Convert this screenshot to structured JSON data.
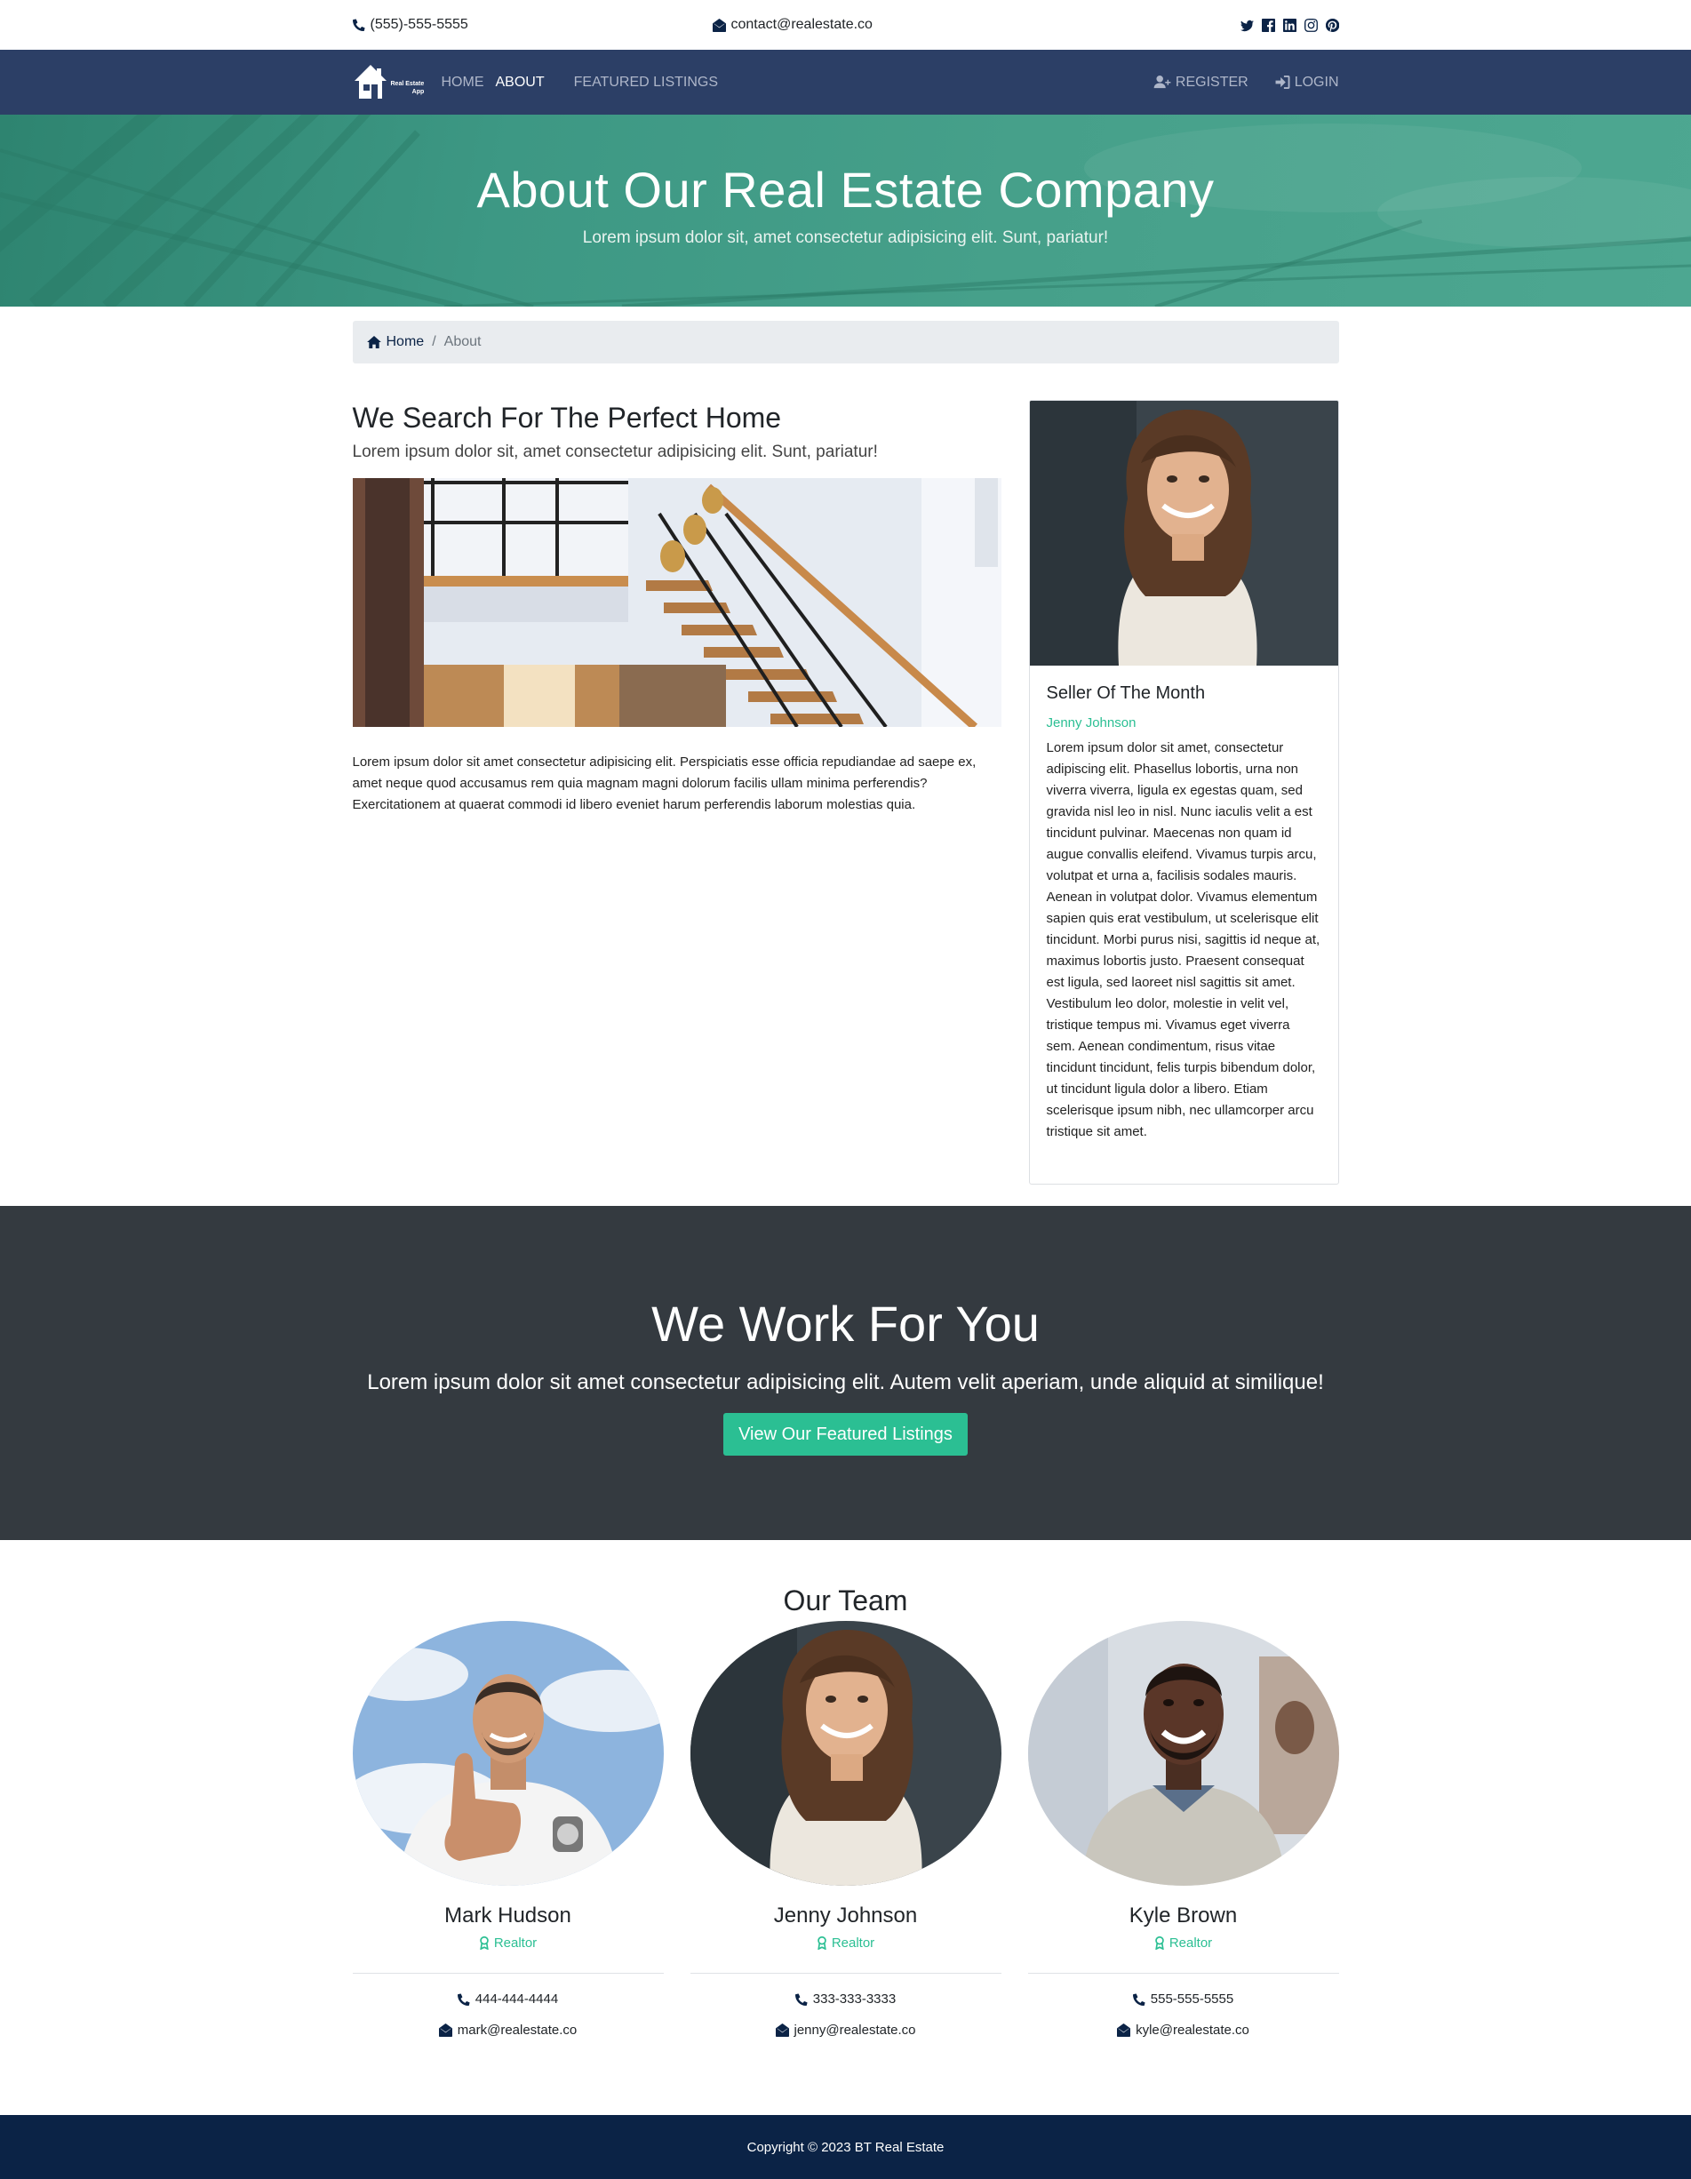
{
  "topbar": {
    "phone": "(555)-555-5555",
    "email": "contact@realestate.co",
    "social_icons": [
      "twitter-icon",
      "facebook-icon",
      "linkedin-icon",
      "instagram-icon",
      "pinterest-icon"
    ]
  },
  "navbar": {
    "logo_text_1": "Real Estate",
    "logo_text_2": "App",
    "links": [
      "HOME",
      "ABOUT",
      "FEATURED LISTINGS"
    ],
    "register": "REGISTER",
    "login": "LOGIN"
  },
  "hero": {
    "title": "About Our Real Estate Company",
    "subtitle": "Lorem ipsum dolor sit, amet consectetur adipisicing elit. Sunt, pariatur!"
  },
  "breadcrumb": {
    "home": "Home",
    "current": "About"
  },
  "about": {
    "title": "We Search For The Perfect Home",
    "lead": "Lorem ipsum dolor sit, amet consectetur adipisicing elit. Sunt, pariatur!",
    "body": "Lorem ipsum dolor sit amet consectetur adipisicing elit. Perspiciatis esse officia repudiandae ad saepe ex, amet neque quod accusamus rem quia magnam magni dolorum facilis ullam minima perferendis? Exercitationem at quaerat commodi id libero eveniet harum perferendis laborum molestias quia."
  },
  "seller": {
    "heading": "Seller Of The Month",
    "name": "Jenny Johnson",
    "text": "Lorem ipsum dolor sit amet, consectetur adipiscing elit. Phasellus lobortis, urna non viverra viverra, ligula ex egestas quam, sed gravida nisl leo in nisl. Nunc iaculis velit a est tincidunt pulvinar. Maecenas non quam id augue convallis eleifend. Vivamus turpis arcu, volutpat et urna a, facilisis sodales mauris. Aenean in volutpat dolor. Vivamus elementum sapien quis erat vestibulum, ut scelerisque elit tincidunt. Morbi purus nisi, sagittis id neque at, maximus lobortis justo. Praesent consequat est ligula, sed laoreet nisl sagittis sit amet. Vestibulum leo dolor, molestie in velit vel, tristique tempus mi. Vivamus eget viverra sem. Aenean condimentum, risus vitae tincidunt tincidunt, felis turpis bibendum dolor, ut tincidunt ligula dolor a libero. Etiam scelerisque ipsum nibh, nec ullamcorper arcu tristique sit amet."
  },
  "work": {
    "title": "We Work For You",
    "text": "Lorem ipsum dolor sit amet consectetur adipisicing elit. Autem velit aperiam, unde aliquid at similique!",
    "button": "View Our Featured Listings"
  },
  "team": {
    "title": "Our Team",
    "members": [
      {
        "name": "Mark Hudson",
        "role": "Realtor",
        "phone": "444-444-4444",
        "email": "mark@realestate.co"
      },
      {
        "name": "Jenny Johnson",
        "role": "Realtor",
        "phone": "333-333-3333",
        "email": "jenny@realestate.co"
      },
      {
        "name": "Kyle Brown",
        "role": "Realtor",
        "phone": "555-555-5555",
        "email": "kyle@realestate.co"
      }
    ]
  },
  "footer": {
    "copyright": "Copyright © 2023 BT Real Estate"
  },
  "colors": {
    "navy": "#2c3f66",
    "footer": "#0b2346",
    "accent": "#2bbf93",
    "dark": "#343a40",
    "hero": "#46a08a"
  }
}
